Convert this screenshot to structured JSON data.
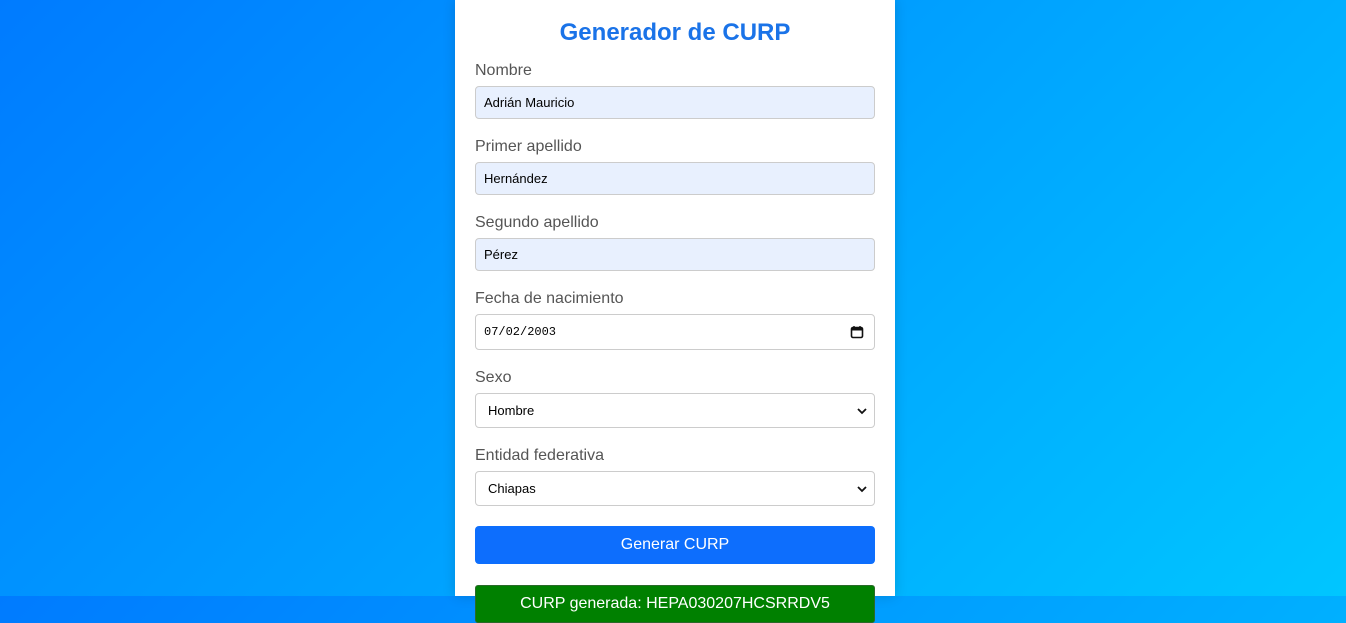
{
  "form": {
    "title": "Generador de CURP",
    "nombre": {
      "label": "Nombre",
      "value": "Adrián Mauricio"
    },
    "primer_apellido": {
      "label": "Primer apellido",
      "value": "Hernández"
    },
    "segundo_apellido": {
      "label": "Segundo apellido",
      "value": "Pérez"
    },
    "fecha": {
      "label": "Fecha de nacimiento",
      "value": "07/02/2003"
    },
    "sexo": {
      "label": "Sexo",
      "value": "Hombre"
    },
    "entidad": {
      "label": "Entidad federativa",
      "value": "Chiapas"
    },
    "submit_label": "Generar CURP",
    "result_text": "CURP generada: HEPA030207HCSRRDV5"
  },
  "colors": {
    "title": "#1a73e8",
    "button": "#0d6efd",
    "result": "#008000",
    "autofill": "#e8f0fe",
    "background_start": "#007bff",
    "background_end": "#00c6ff"
  },
  "icons": {
    "date": "calendar-icon",
    "select": "chevron-down-icon"
  }
}
